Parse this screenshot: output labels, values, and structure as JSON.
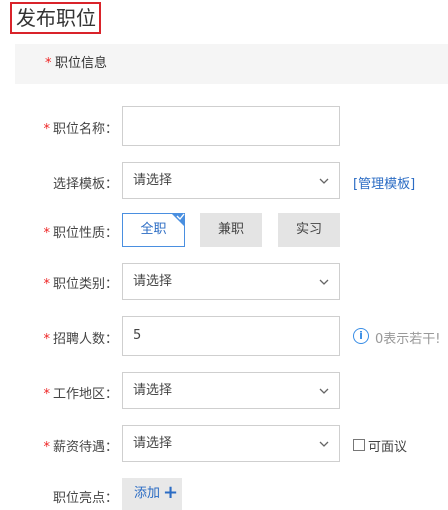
{
  "page": {
    "title": "发布职位"
  },
  "section": {
    "star": "*",
    "title": "职位信息"
  },
  "form": {
    "required_star": "*",
    "job_name": {
      "label": "职位名称：",
      "value": ""
    },
    "template": {
      "label": "选择模板：",
      "value": "请选择",
      "link": "[管理模板]"
    },
    "job_nature": {
      "label": "职位性质：",
      "options": [
        "全职",
        "兼职",
        "实习"
      ],
      "selected": "全职"
    },
    "category": {
      "label": "职位类别：",
      "value": "请选择"
    },
    "headcount": {
      "label": "招聘人数：",
      "value": "5",
      "hint_icon": "i",
      "hint": "0表示若干!"
    },
    "location": {
      "label": "工作地区：",
      "value": "请选择"
    },
    "salary": {
      "label": "薪资待遇：",
      "value": "请选择",
      "checkbox_label": "可面议",
      "checked": false
    },
    "highlights": {
      "label": "职位亮点：",
      "add_label": "添加",
      "add_icon": "+"
    }
  },
  "colors": {
    "accent": "#2b6cc4",
    "required": "#e22222",
    "title_border": "#d9232a"
  },
  "icons": [
    "chevron-down-icon",
    "check-corner-icon",
    "info-icon",
    "plus-icon"
  ]
}
